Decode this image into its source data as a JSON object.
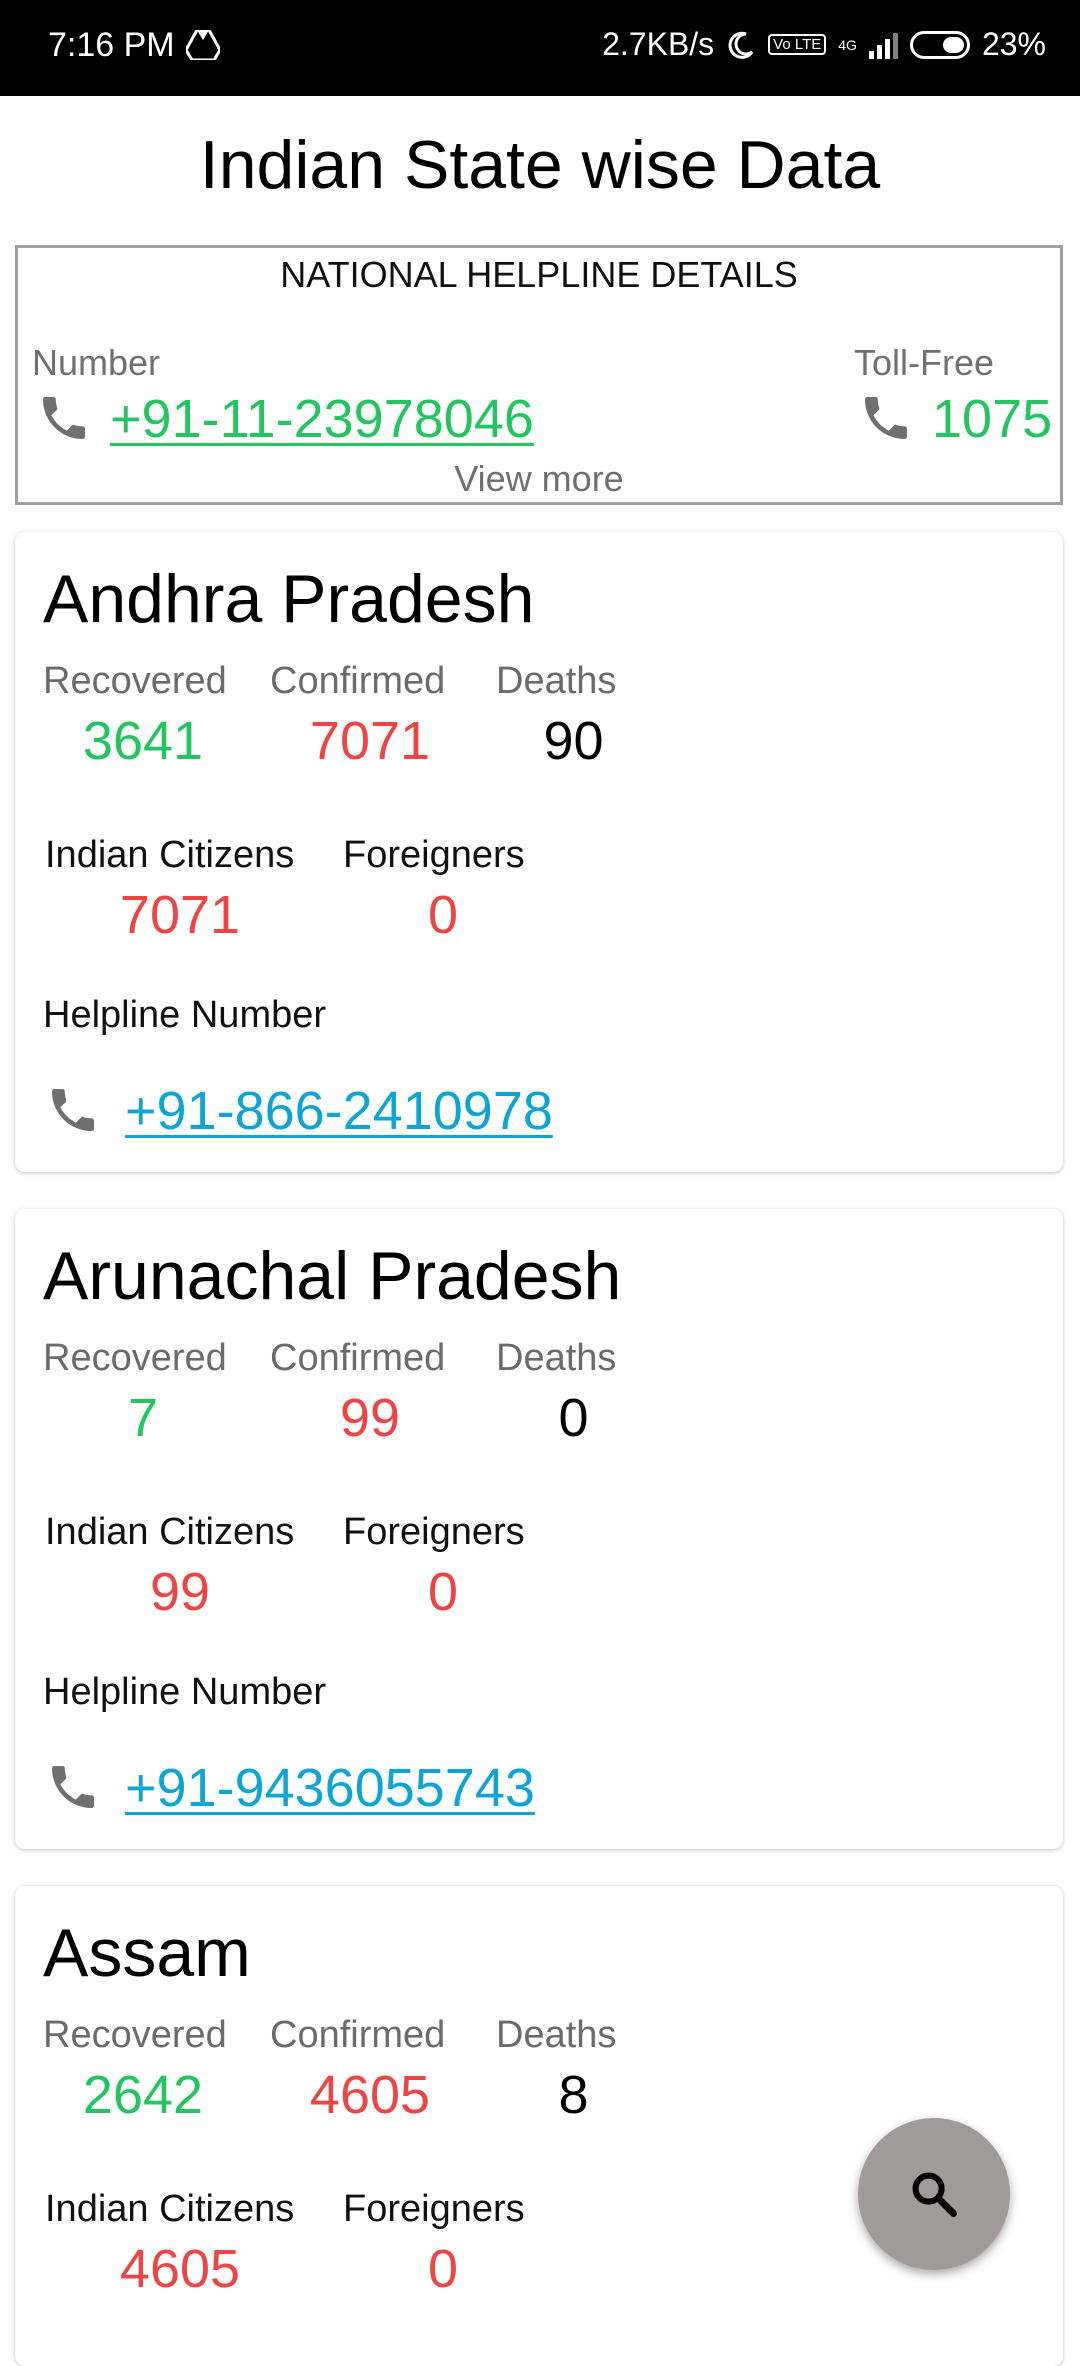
{
  "status_bar": {
    "time": "7:16 PM",
    "speed": "2.7KB/s",
    "volte": "Vo LTE",
    "network": "4G",
    "battery": "23%"
  },
  "header": {
    "title": "Indian State wise Data"
  },
  "national_helpline": {
    "heading": "NATIONAL HELPLINE DETAILS",
    "number_label": "Number",
    "number": "+91-11-23978046",
    "tollfree_label": "Toll-Free",
    "tollfree": "1075",
    "view_more": "View more"
  },
  "labels": {
    "recovered": "Recovered",
    "confirmed": "Confirmed",
    "deaths": "Deaths",
    "indian": "Indian Citizens",
    "foreign": "Foreigners",
    "helpline": "Helpline Number"
  },
  "states": [
    {
      "name": "Andhra Pradesh",
      "recovered": "3641",
      "confirmed": "7071",
      "deaths": "90",
      "indian": "7071",
      "foreign": "0",
      "helpline": "+91-866-2410978"
    },
    {
      "name": "Arunachal Pradesh",
      "recovered": "7",
      "confirmed": "99",
      "deaths": "0",
      "indian": "99",
      "foreign": "0",
      "helpline": "+91-9436055743"
    },
    {
      "name": "Assam",
      "recovered": "2642",
      "confirmed": "4605",
      "deaths": "8",
      "indian": "4605",
      "foreign": "0",
      "helpline": ""
    }
  ],
  "colors": {
    "recovered": "#22c55e",
    "confirmed": "#ef4444",
    "link": "#0ea5d6",
    "fab": "#a09b9b"
  },
  "icons": {
    "phone": "phone-icon",
    "search": "search-icon"
  }
}
